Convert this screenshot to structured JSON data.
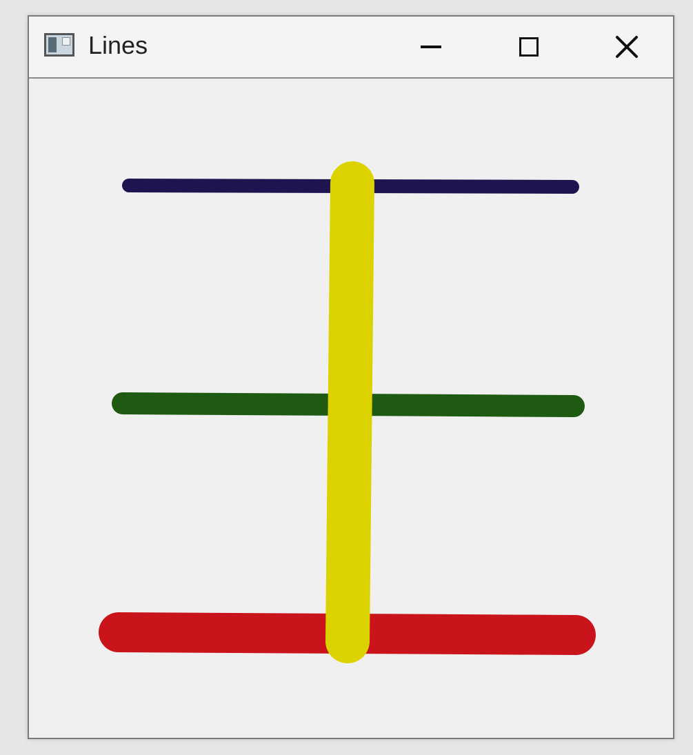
{
  "window": {
    "title": "Lines",
    "controls": {
      "minimize_icon": "minimize-icon",
      "maximize_icon": "maximize-icon",
      "close_icon": "close-icon"
    }
  },
  "canvas": {
    "lines": [
      {
        "name": "navy-line",
        "color": "#1e1450",
        "orientation": "horizontal",
        "thickness": "thin"
      },
      {
        "name": "green-line",
        "color": "#1f5a12",
        "orientation": "horizontal",
        "thickness": "medium"
      },
      {
        "name": "red-line",
        "color": "#c8141a",
        "orientation": "horizontal",
        "thickness": "thick"
      },
      {
        "name": "yellow-line",
        "color": "#dcd200",
        "orientation": "vertical",
        "thickness": "thickest"
      }
    ]
  }
}
